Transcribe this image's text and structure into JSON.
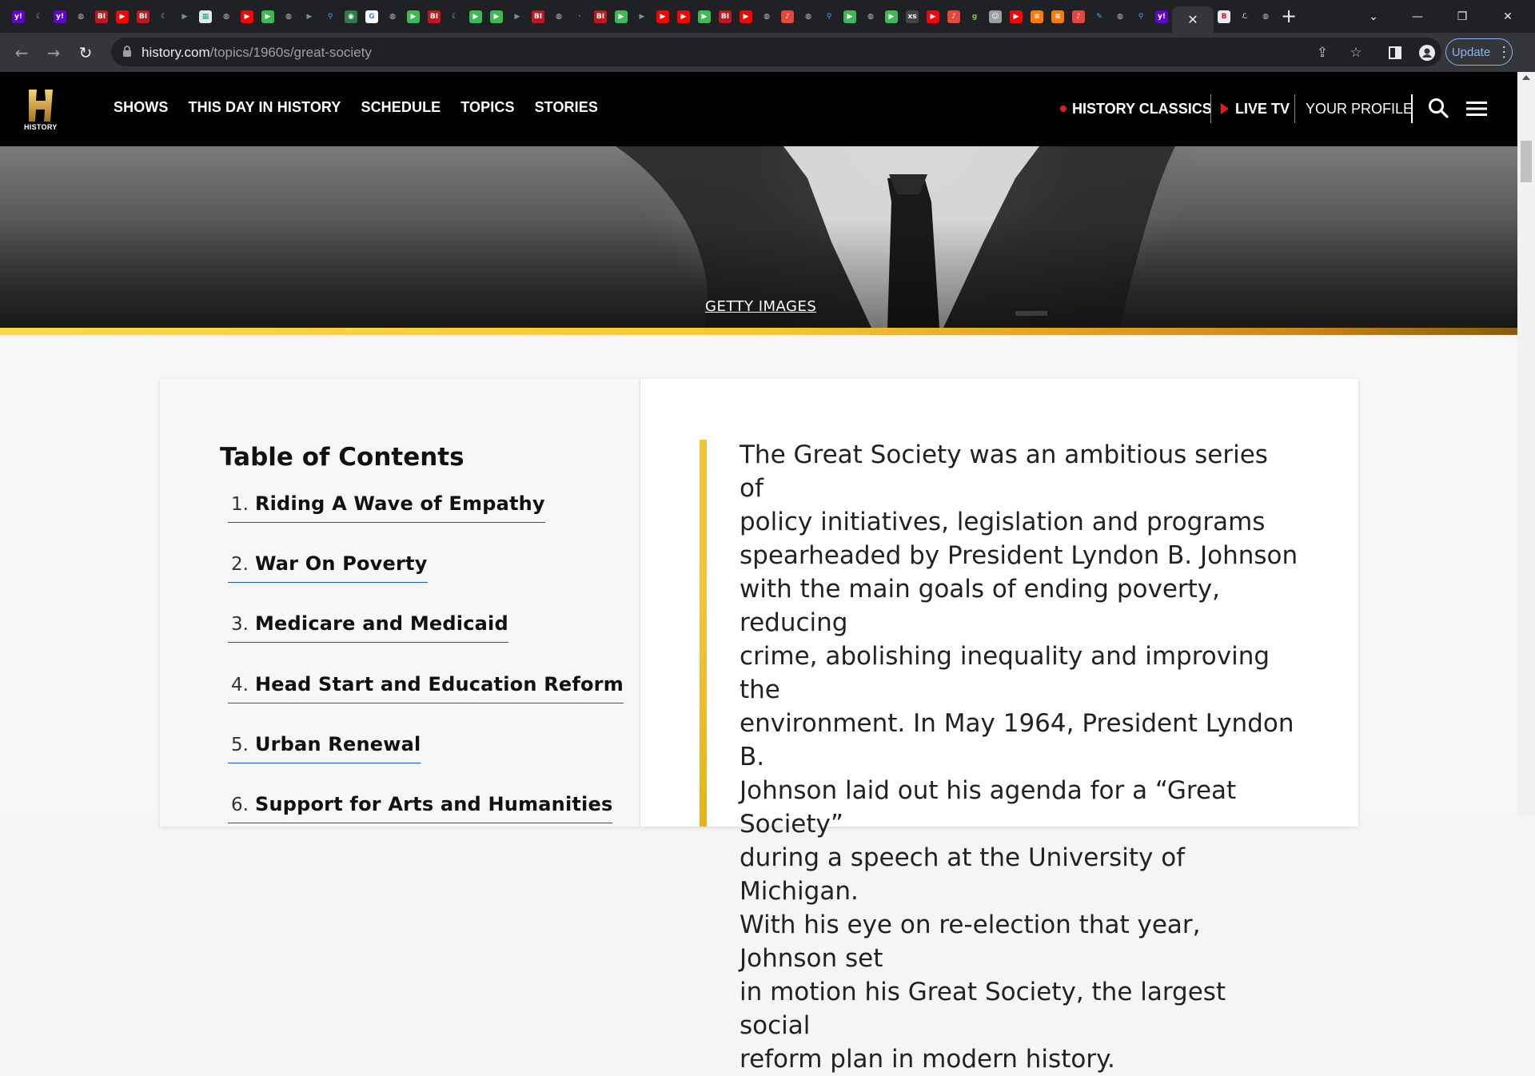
{
  "browser": {
    "url_host": "history.com",
    "url_path": "/topics/1960s/great-society",
    "update_label": "Update",
    "active_tab_close": "✕",
    "new_tab": "+"
  },
  "tab_favicons": [
    "yahoo",
    "vpn",
    "yahoo",
    "globe",
    "bi",
    "youtube",
    "bi",
    "vpn",
    "forward",
    "grid",
    "globe",
    "youtube",
    "play",
    "globe",
    "forward",
    "search",
    "map",
    "google",
    "globe",
    "play",
    "bi",
    "vpn",
    "play",
    "play",
    "forward",
    "bi",
    "globe",
    "blank",
    "bi",
    "play",
    "forward",
    "youtube",
    "youtube",
    "play",
    "bi",
    "youtube",
    "globe",
    "podcast",
    "globe",
    "search",
    "play",
    "globe",
    "play",
    "xs",
    "youtube",
    "podcast",
    "goodreads",
    "avatar",
    "youtube",
    "bookmark",
    "bookmark",
    "podcast",
    "tool",
    "globe",
    "search",
    "yahoo",
    "bi-active",
    "brand",
    "globe"
  ],
  "site": {
    "logo_text": "HISTORY",
    "nav": [
      "SHOWS",
      "THIS DAY IN HISTORY",
      "SCHEDULE",
      "TOPICS",
      "STORIES"
    ],
    "history_classics": "HISTORY CLASSICS",
    "live_tv": "LIVE TV",
    "your_profile": "YOUR PROFILE"
  },
  "hero": {
    "credit": "GETTY IMAGES"
  },
  "toc": {
    "title": "Table of Contents",
    "items": [
      {
        "num": "1.",
        "label": "Riding A Wave of Empathy"
      },
      {
        "num": "2.",
        "label": "War On Poverty"
      },
      {
        "num": "3.",
        "label": "Medicare and Medicaid"
      },
      {
        "num": "4.",
        "label": "Head Start and Education Reform"
      },
      {
        "num": "5.",
        "label": "Urban Renewal"
      },
      {
        "num": "6.",
        "label": "Support for Arts and Humanities"
      }
    ]
  },
  "article": {
    "lede_lines": [
      "The Great Society was an ambitious series of",
      "policy initiatives, legislation and programs",
      "spearheaded by President Lyndon B. Johnson",
      "with the main goals of ending poverty, reducing",
      "crime, abolishing inequality and improving the",
      "environment. In May 1964, President Lyndon B.",
      "Johnson laid out his agenda for a “Great Society”",
      "during a speech at the University of Michigan.",
      "With his eye on re-election that year, Johnson set",
      "in motion his Great Society, the largest social",
      "reform plan in modern history."
    ]
  },
  "colors": {
    "tab_bg": "#202124",
    "toolbar_bg": "#35363a",
    "site_header_bg": "#000000",
    "accent_gold": "#f7c931",
    "link_underline": "#1a56c4",
    "live_red": "#e31b23"
  }
}
